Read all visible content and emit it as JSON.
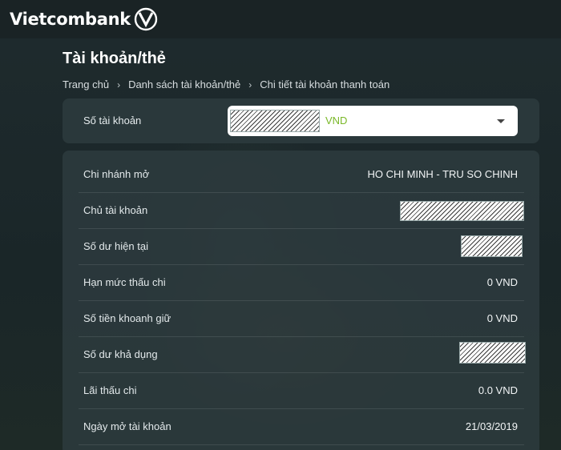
{
  "header": {
    "logo_text": "Vietcombank",
    "logo_icon": "vietcombank-logo-icon"
  },
  "page": {
    "title": "Tài khoản/thẻ"
  },
  "breadcrumb": {
    "items": [
      "Trang chủ",
      "Danh sách tài khoản/thẻ",
      "Chi tiết tài khoản thanh toán"
    ],
    "separator": "›"
  },
  "account_selector": {
    "label": "Số tài khoản",
    "currency": "VND"
  },
  "details": [
    {
      "label": "Chi nhánh mở",
      "value": "HO CHI MINH - TRU SO CHINH"
    },
    {
      "label": "Chủ tài khoản",
      "value": null
    },
    {
      "label": "Số dư hiện tại",
      "value": null
    },
    {
      "label": "Hạn mức thấu chi",
      "value": "0 VND"
    },
    {
      "label": "Số tiền khoanh giữ",
      "value": "0 VND"
    },
    {
      "label": "Số dư khả dụng",
      "value": null
    },
    {
      "label": "Lãi thấu chi",
      "value": "0.0 VND"
    },
    {
      "label": "Ngày mở tài khoản",
      "value": "21/03/2019"
    }
  ],
  "colors": {
    "accent_green": "#7ab828",
    "background": "#1c2a2c"
  }
}
